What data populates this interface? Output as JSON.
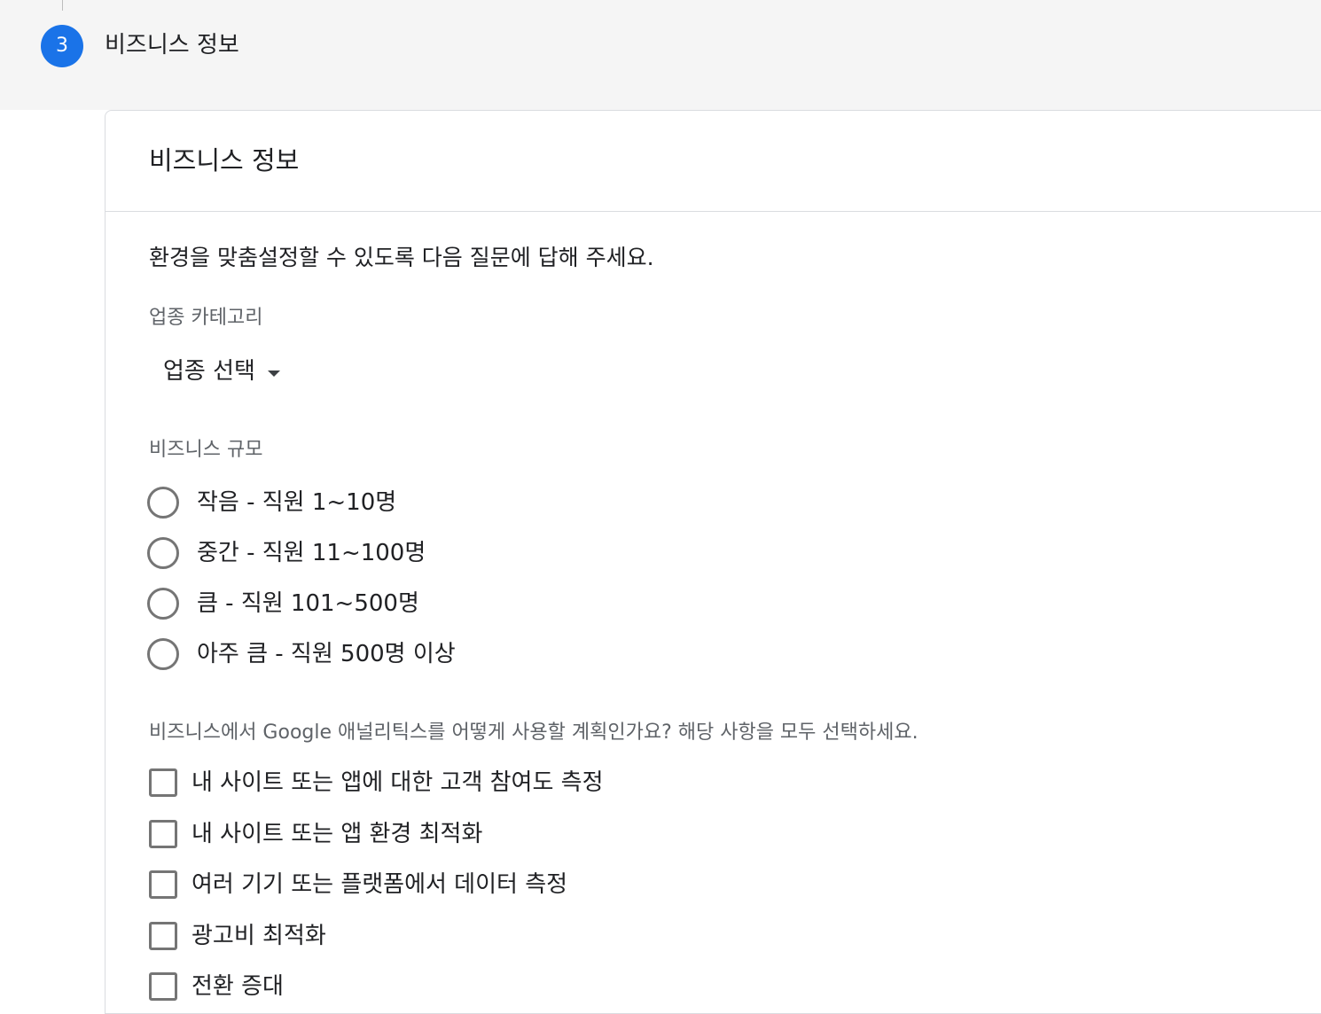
{
  "stepper": {
    "step_number": "3",
    "step_title": "비즈니스 정보"
  },
  "card": {
    "title": "비즈니스 정보",
    "intro": "환경을 맞춤설정할 수 있도록 다음 질문에 답해 주세요."
  },
  "industry": {
    "label": "업종 카테고리",
    "dropdown_value": "업종 선택"
  },
  "business_size": {
    "label": "비즈니스 규모",
    "options": [
      {
        "label": "작음 - 직원 1~10명",
        "selected": false
      },
      {
        "label": "중간 - 직원 11~100명",
        "selected": false
      },
      {
        "label": "큼 - 직원 101~500명",
        "selected": false
      },
      {
        "label": "아주 큼 - 직원 500명 이상",
        "selected": false
      }
    ]
  },
  "usage": {
    "label": "비즈니스에서 Google 애널리틱스를 어떻게 사용할 계획인가요? 해당 사항을 모두 선택하세요.",
    "options": [
      {
        "label": "내 사이트 또는 앱에 대한 고객 참여도 측정",
        "checked": false
      },
      {
        "label": "내 사이트 또는 앱 환경 최적화",
        "checked": false
      },
      {
        "label": "여러 기기 또는 플랫폼에서 데이터 측정",
        "checked": false
      },
      {
        "label": "광고비 최적화",
        "checked": false
      },
      {
        "label": "전환 증대",
        "checked": false
      }
    ]
  },
  "colors": {
    "accent": "#1a73e8",
    "background_band": "#f5f5f5",
    "control_border": "#757575"
  }
}
